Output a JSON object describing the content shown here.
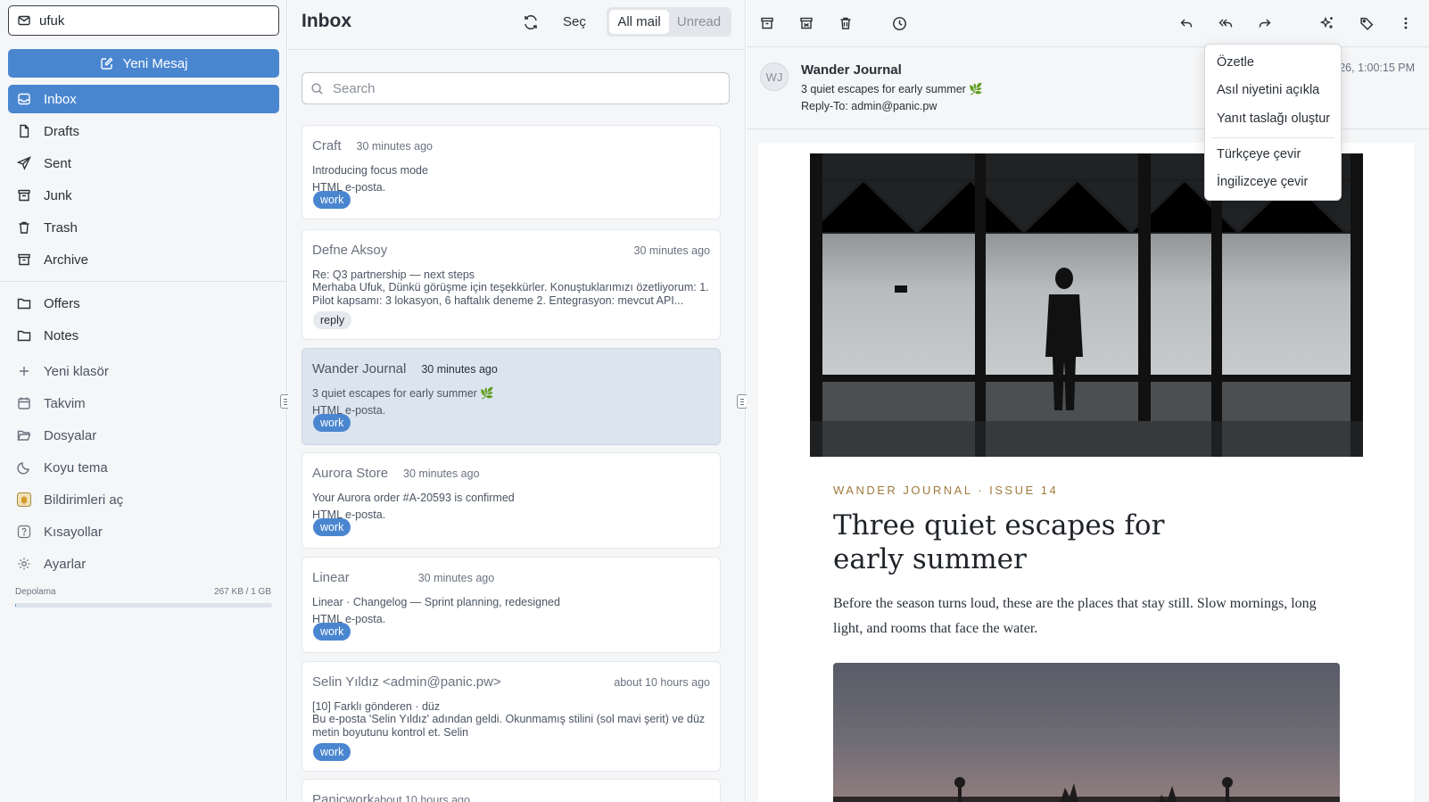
{
  "sidebar": {
    "account": "ufuk",
    "compose_label": "Yeni Mesaj",
    "folders": [
      {
        "label": "Inbox",
        "icon": "inbox-icon",
        "active": true
      },
      {
        "label": "Drafts",
        "icon": "file-icon"
      },
      {
        "label": "Sent",
        "icon": "send-icon"
      },
      {
        "label": "Junk",
        "icon": "junk-icon"
      },
      {
        "label": "Trash",
        "icon": "trash-icon"
      },
      {
        "label": "Archive",
        "icon": "archive-icon"
      }
    ],
    "custom_folders": [
      {
        "label": "Offers",
        "icon": "folder-icon"
      },
      {
        "label": "Notes",
        "icon": "folder-icon"
      }
    ],
    "actions": [
      {
        "label": "Yeni klasör",
        "icon": "plus-icon"
      },
      {
        "label": "Takvim",
        "icon": "calendar-icon"
      },
      {
        "label": "Dosyalar",
        "icon": "folder-open-icon"
      },
      {
        "label": "Koyu tema",
        "icon": "moon-icon"
      },
      {
        "label": "Bildirimleri aç",
        "icon": "bell-icon"
      },
      {
        "label": "Kısayollar",
        "icon": "help-icon"
      },
      {
        "label": "Ayarlar",
        "icon": "settings-icon"
      }
    ],
    "storage": {
      "label": "Depolama",
      "value": "267 KB / 1 GB",
      "fraction": 0.0003
    }
  },
  "list": {
    "title": "Inbox",
    "select_label": "Seç",
    "filter": {
      "all": "All mail",
      "unread": "Unread",
      "active": "all"
    },
    "search_placeholder": "Search",
    "messages": [
      {
        "from": "Craft",
        "time": "30 minutes ago",
        "subject": "Introducing focus mode",
        "preview": "HTML e-posta.",
        "tag": "work"
      },
      {
        "from": "Defne Aksoy",
        "time": "30 minutes ago",
        "subject": "Re: Q3 partnership — next steps",
        "preview": "Merhaba Ufuk, Dünkü görüşme için teşekkürler. Konuştuklarımızı özetliyorum: 1. Pilot kapsamı: 3 lokasyon, 6 haftalık deneme 2. Entegrasyon: mevcut API...",
        "tag": "reply"
      },
      {
        "from": "Wander Journal",
        "time": "30 minutes ago",
        "subject": "3 quiet escapes for early summer 🌿",
        "preview": "HTML e-posta.",
        "tag": "work",
        "selected": true
      },
      {
        "from": "Aurora Store",
        "time": "30 minutes ago",
        "subject": "Your Aurora order #A-20593 is confirmed",
        "preview": "HTML e-posta.",
        "tag": "work"
      },
      {
        "from": "Linear",
        "time": "30 minutes ago",
        "subject": "Linear · Changelog — Sprint planning, redesigned",
        "preview": "HTML e-posta.",
        "tag": "work"
      },
      {
        "from": "Selin Yıldız <admin@panic.pw>",
        "time": "about 10 hours ago",
        "subject": "[10] Farklı gönderen · düz",
        "preview": "Bu e-posta 'Selin Yıldız' adından geldi. Okunmamış stilini (sol mavi şerit) ve düz metin boyutunu kontrol et. Selin",
        "tag": "work"
      },
      {
        "from": "Panicwork",
        "time": "about 10 hours ago",
        "subject": "",
        "preview": "",
        "tag": ""
      }
    ]
  },
  "reader": {
    "avatar_initials": "WJ",
    "sender": "Wander Journal",
    "subject": "3 quiet escapes for early summer 🌿",
    "reply_to_label": "Reply-To:",
    "reply_to": "admin@panic.pw",
    "date_visible": "26, 1:00:15 PM",
    "body": {
      "kicker": "WANDER JOURNAL · ISSUE 14",
      "headline": "Three quiet escapes for early summer",
      "lede": "Before the season turns loud, these are the places that stay still. Slow mornings, long light, and rooms that face the water."
    }
  },
  "ai_menu": {
    "items": [
      "Özetle",
      "Asıl niyetini açıkla",
      "Yanıt taslağı oluştur"
    ],
    "translate_items": [
      "Türkçeye çevir",
      "İngilizceye çevir"
    ]
  },
  "colors": {
    "accent": "#4a86d0",
    "kicker": "#a07a3c"
  }
}
